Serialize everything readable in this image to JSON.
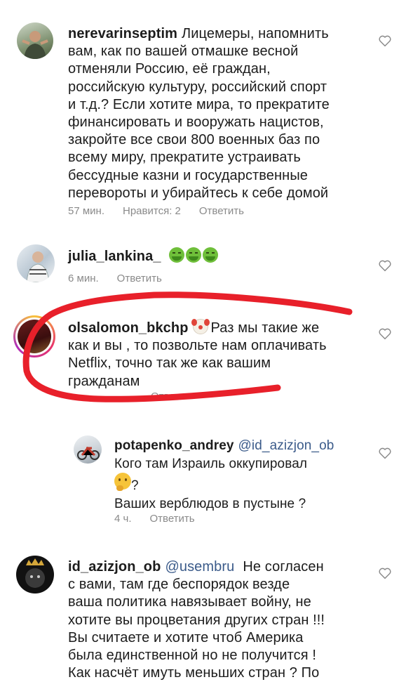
{
  "comments": [
    {
      "username": "nerevarinseptim",
      "text": "Лицемеры, напомнить вам, как по вашей отмашке весной отменяли Россию, её граждан, российскую культуру, российский спорт и т.д.? Если хотите мира, то прекратите финансировать и вооружать нацистов, закройте все свои 800 военных баз по всему миру, прекратите устраивать бессудные казни и государственные перевороты и убирайтесь к себе домой",
      "lines": [
        "вам, как по вашей отмашке весной",
        "отменяли Россию, её граждан,",
        "российскую культуру, российский спорт",
        "и т.д.? Если хотите мира, то прекратите",
        "финансировать и вооружать нацистов,",
        "закройте все свои 800 военных баз по",
        "всему миру, прекратите устраивать",
        "бессудные казни и государственные",
        "перевороты и убирайтесь к себе домой"
      ],
      "first_line": "Лицемеры, напомнить",
      "time": "57 мин.",
      "likes": "Нравится: 2",
      "reply": "Ответить"
    },
    {
      "username": "julia_lankina_",
      "emoji": "nauseated-face x3",
      "time": "6 мин.",
      "reply": "Ответить"
    },
    {
      "username": "olsalomon_bkchp",
      "emoji": "clown-face",
      "first_line": "Раз мы такие же",
      "lines": [
        "как и вы , то позвольте нам оплачивать",
        "Netflix, точно так же как вашим",
        "гражданам"
      ],
      "hidden_meta": "Ответить"
    },
    {
      "username": "potapenko_andrey",
      "mention": "@id_azizjon_ob",
      "lines": [
        "Кого там Израиль оккупировал",
        "?",
        "Ваших верблюдов в пустыне ?"
      ],
      "emoji": "thinking-face",
      "time": "4 ч.",
      "reply": "Ответить"
    },
    {
      "username": "id_azizjon_ob",
      "mention": "@usembru",
      "first_line": "Не согласен",
      "lines": [
        "с вами, там где беспорядок везде",
        "ваша политика  навязывает войну, не",
        "хотите вы процветания других стран !!!",
        "Вы считаете и хотите чтоб Америка",
        "была единственной но не получится !",
        "Как насчёт имуть меньших стран ? По"
      ]
    }
  ],
  "colors": {
    "annotation_red": "#e8202a",
    "meta_gray": "#8a8a8a",
    "mention_blue": "#3b5b8a"
  },
  "icons": [
    "like-heart-icon"
  ]
}
